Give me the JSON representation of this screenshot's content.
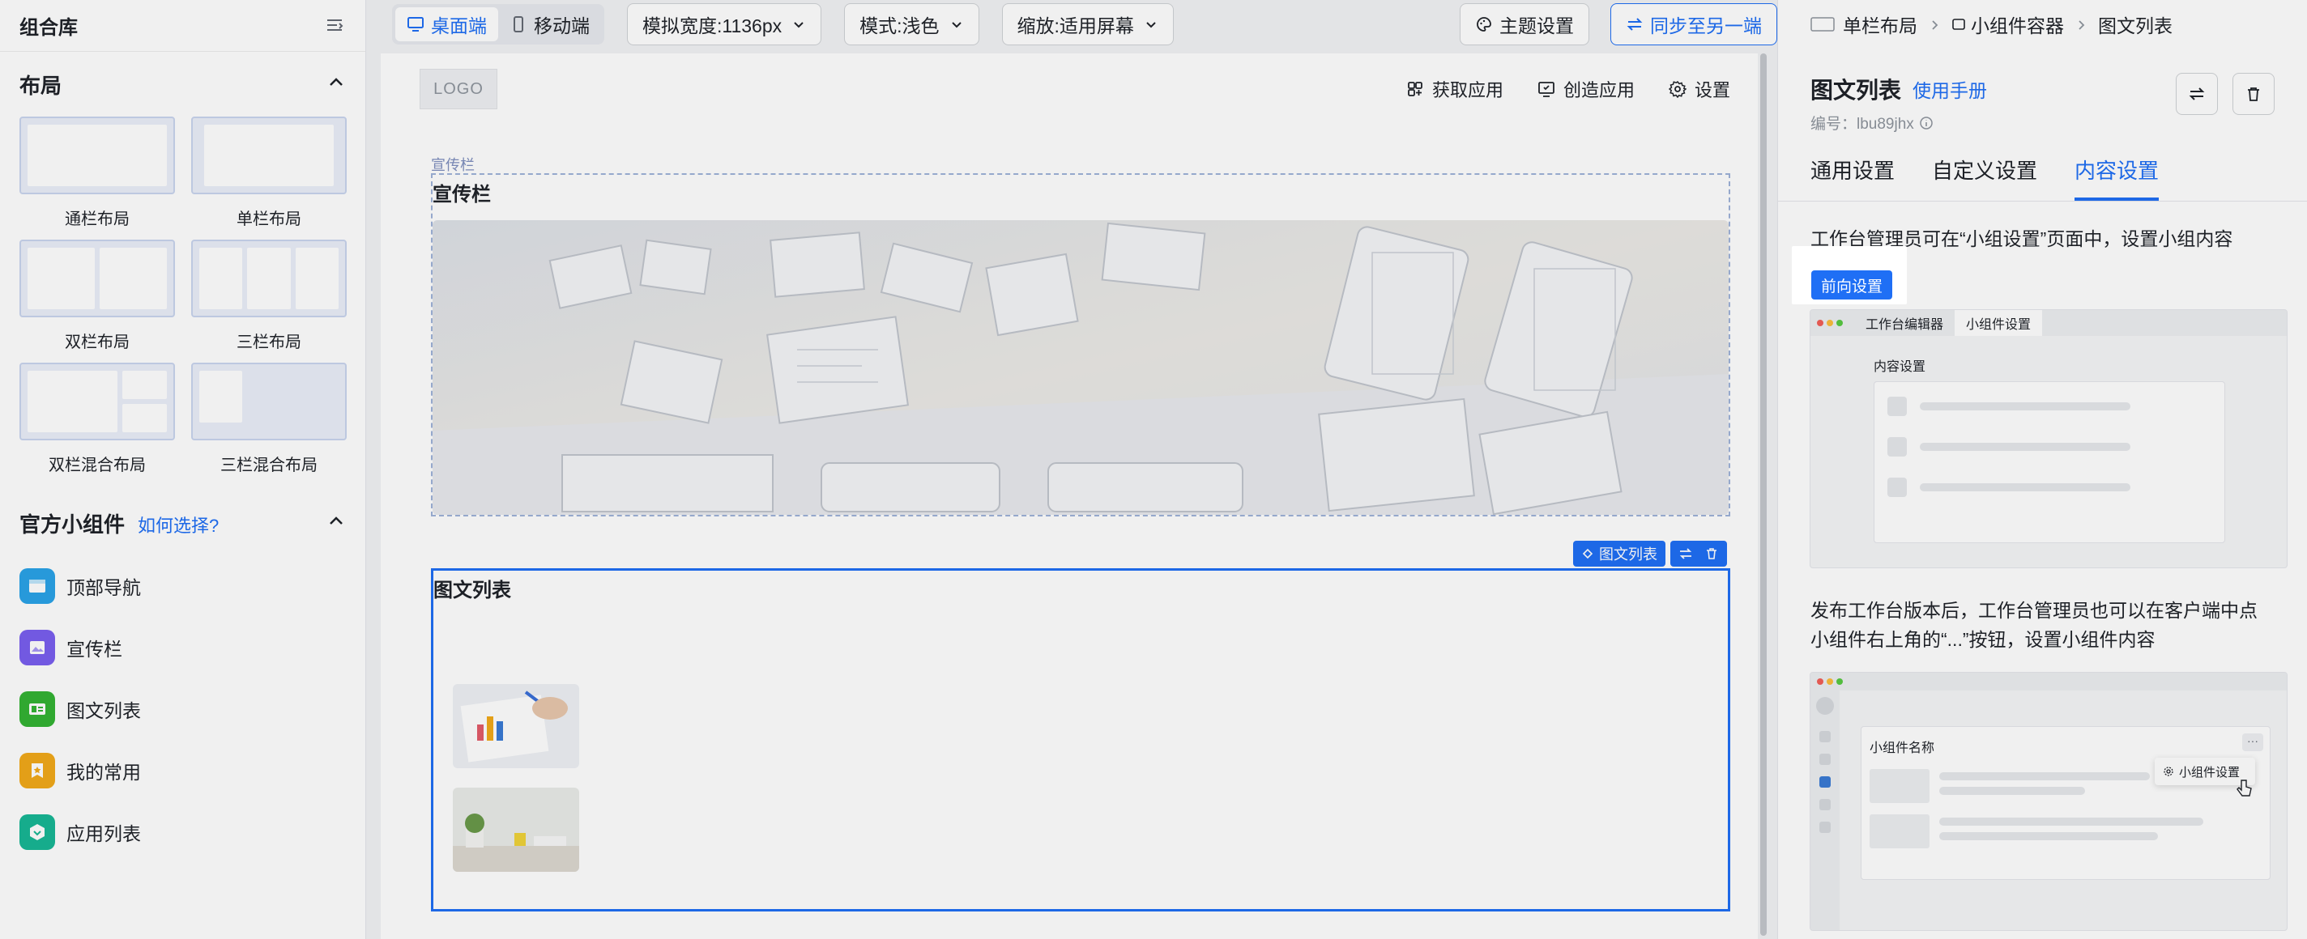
{
  "left": {
    "title": "组合库",
    "layout_section": {
      "title": "布局",
      "items": [
        {
          "label": "通栏布局"
        },
        {
          "label": "单栏布局"
        },
        {
          "label": "双栏布局"
        },
        {
          "label": "三栏布局"
        },
        {
          "label": "双栏混合布局"
        },
        {
          "label": "三栏混合布局"
        }
      ]
    },
    "widget_section": {
      "title": "官方小组件",
      "link": "如何选择?",
      "items": [
        {
          "label": "顶部导航",
          "icon": "top-nav-icon",
          "color": "#2aa3e8"
        },
        {
          "label": "宣传栏",
          "icon": "banner-icon",
          "color": "#7a5ff0"
        },
        {
          "label": "图文列表",
          "icon": "image-text-list-icon",
          "color": "#34b334"
        },
        {
          "label": "我的常用",
          "icon": "favorites-icon",
          "color": "#f2a91a"
        },
        {
          "label": "应用列表",
          "icon": "app-list-icon",
          "color": "#18b795"
        }
      ]
    }
  },
  "toolbar": {
    "desktop": "桌面端",
    "mobile": "移动端",
    "width": "模拟宽度:1136px",
    "mode": "模式:浅色",
    "zoom": "缩放:适用屏幕",
    "theme": "主题设置",
    "sync": "同步至另一端"
  },
  "canvas": {
    "logo": "LOGO",
    "nav": {
      "get_app": "获取应用",
      "create_app": "创造应用",
      "settings": "设置"
    },
    "banner_tag": "宣传栏",
    "banner_title": "宣传栏",
    "list_tag": "图文列表",
    "list_title": "图文列表"
  },
  "right": {
    "breadcrumb": [
      "单栏布局",
      "小组件容器",
      "图文列表"
    ],
    "title": "图文列表",
    "manual": "使用手册",
    "id": "编号：lbu89jhx",
    "tabs": [
      "通用设置",
      "自定义设置",
      "内容设置"
    ],
    "active_tab": "内容设置",
    "text1": "工作台管理员可在“小组设置”页面中，设置小组内容",
    "forward_button": "前向设置",
    "mock1": {
      "tab1": "工作台编辑器",
      "tab2": "小组件设置",
      "heading": "内容设置"
    },
    "text2": "发布工作台版本后，工作台管理员也可以在客户端中点小组件右上角的“...”按钮，设置小组件内容",
    "mock2": {
      "card_title": "小组件名称",
      "menu_item": "小组件设置"
    },
    "accent": "#1f6ff5"
  }
}
